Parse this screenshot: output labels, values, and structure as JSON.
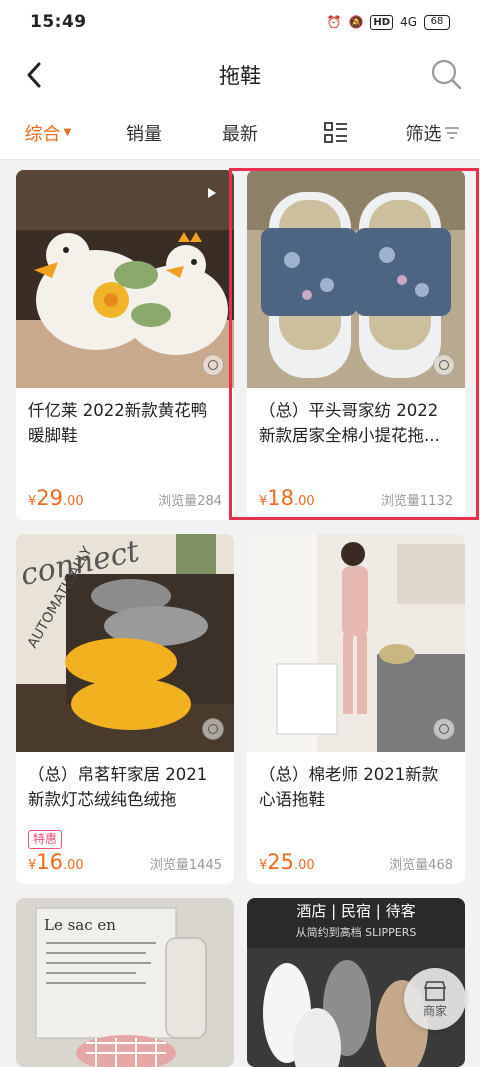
{
  "status_bar": {
    "time": "15:49",
    "hd": "HD",
    "signal": "4G",
    "battery": "68"
  },
  "nav": {
    "title": "拖鞋"
  },
  "tabs": [
    {
      "label": "综合",
      "active": true
    },
    {
      "label": "销量"
    },
    {
      "label": "最新"
    },
    {
      "label": ""
    },
    {
      "label": "筛选"
    }
  ],
  "products": [
    {
      "name": "仟亿莱 2022新款黄花鸭暖脚鞋",
      "price_int": "29",
      "price_dec": ".00",
      "currency": "¥",
      "views": "浏览量284"
    },
    {
      "name": "（总）平头哥家纺 2022新款居家全棉小提花拖...",
      "price_int": "18",
      "price_dec": ".00",
      "currency": "¥",
      "views": "浏览量1132"
    },
    {
      "name": "（总）帛茗轩家居 2021新款灯芯绒纯色绒拖",
      "badge": "特惠",
      "price_int": "16",
      "price_dec": ".00",
      "currency": "¥",
      "views": "浏览量1445"
    },
    {
      "name": "（总）棉老师 2021新款心语拖鞋",
      "price_int": "25",
      "price_dec": ".00",
      "currency": "¥",
      "views": "浏览量468"
    }
  ],
  "image_text": {
    "img3_word": "connect",
    "img3_word2": "AUTOMATICALLY",
    "img5_brand": "Le sac en",
    "img6_top": "酒店 | 民宿 | 待客",
    "img6_sub": "从简约到高档 SLIPPERS"
  },
  "float_button": {
    "label": "商家"
  }
}
